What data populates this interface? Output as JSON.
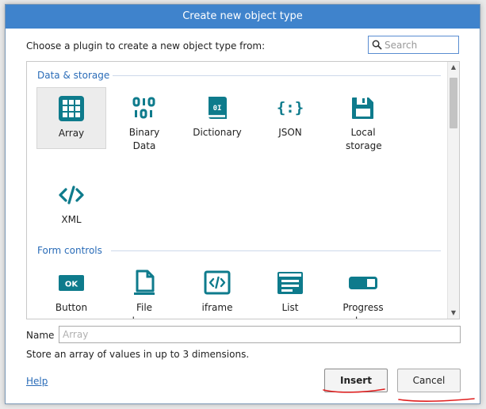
{
  "dialog": {
    "title": "Create new object type",
    "prompt": "Choose a plugin to create a new object type from:",
    "search": {
      "placeholder": "Search",
      "value": ""
    },
    "groups": [
      {
        "name": "Data & storage",
        "items": [
          {
            "label": "Array",
            "icon": "grid-icon",
            "selected": true
          },
          {
            "label": "Binary Data",
            "icon": "binary-icon"
          },
          {
            "label": "Dictionary",
            "icon": "book-icon"
          },
          {
            "label": "JSON",
            "icon": "json-icon"
          },
          {
            "label": "Local storage",
            "icon": "disk-icon"
          },
          {
            "label": "XML",
            "icon": "code-icon"
          }
        ]
      },
      {
        "name": "Form controls",
        "items": [
          {
            "label": "Button",
            "icon": "button-icon"
          },
          {
            "label": "File chooser",
            "icon": "file-icon"
          },
          {
            "label": "iframe",
            "icon": "iframe-icon"
          },
          {
            "label": "List",
            "icon": "list-icon"
          },
          {
            "label": "Progress bar",
            "icon": "progress-icon"
          }
        ]
      }
    ],
    "name_label": "Name",
    "name_placeholder": "Array",
    "description": "Store an array of values in up to 3 dimensions.",
    "help_label": "Help",
    "insert_label": "Insert",
    "cancel_label": "Cancel"
  },
  "colors": {
    "accent": "#3f83cc",
    "icon": "#0e7b8c",
    "link": "#2a6cb8",
    "annotation": "#e01e1e"
  }
}
